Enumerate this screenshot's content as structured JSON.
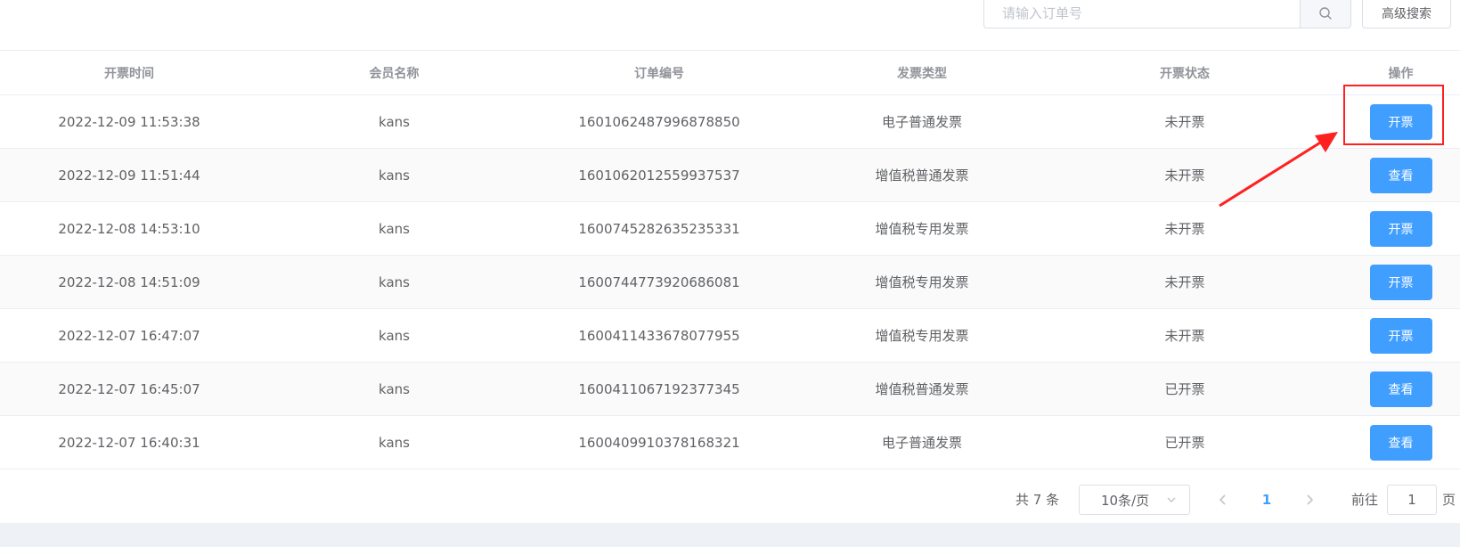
{
  "search": {
    "placeholder": "请输入订单号",
    "advanced_label": "高级搜索"
  },
  "table": {
    "headers": [
      "开票时间",
      "会员名称",
      "订单编号",
      "发票类型",
      "开票状态",
      "操作"
    ],
    "rows": [
      [
        "2022-12-09 11:53:38",
        "kans",
        "1601062487996878850",
        "电子普通发票",
        "未开票",
        "开票"
      ],
      [
        "2022-12-09 11:51:44",
        "kans",
        "1601062012559937537",
        "增值税普通发票",
        "未开票",
        "查看"
      ],
      [
        "2022-12-08 14:53:10",
        "kans",
        "1600745282635235331",
        "增值税专用发票",
        "未开票",
        "开票"
      ],
      [
        "2022-12-08 14:51:09",
        "kans",
        "1600744773920686081",
        "增值税专用发票",
        "未开票",
        "开票"
      ],
      [
        "2022-12-07 16:47:07",
        "kans",
        "1600411433678077955",
        "增值税专用发票",
        "未开票",
        "开票"
      ],
      [
        "2022-12-07 16:45:07",
        "kans",
        "1600411067192377345",
        "增值税普通发票",
        "已开票",
        "查看"
      ],
      [
        "2022-12-07 16:40:31",
        "kans",
        "1600409910378168321",
        "电子普通发票",
        "已开票",
        "查看"
      ]
    ]
  },
  "pagination": {
    "total": "共 7 条",
    "page_size": "10条/页",
    "current_page": "1",
    "goto_prefix": "前往",
    "goto_value": "1",
    "goto_suffix": "页"
  },
  "colors": {
    "primary": "#409eff",
    "annotation": "#ff2020"
  },
  "icons": {
    "search": "search-icon",
    "select": "chevron-down-icon",
    "prev": "chevron-left-icon",
    "next": "chevron-right-icon"
  }
}
